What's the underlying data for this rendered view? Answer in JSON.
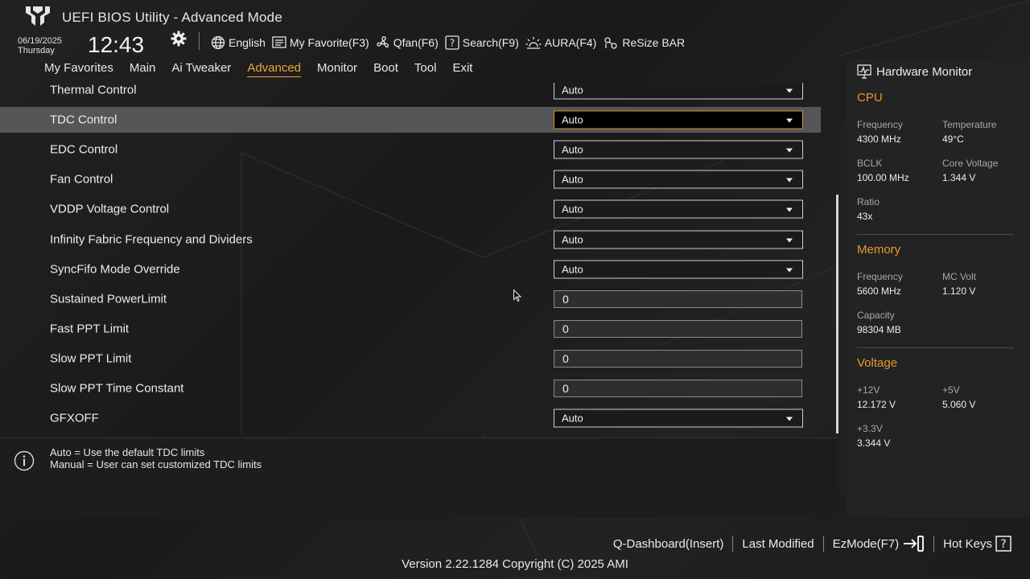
{
  "header": {
    "title": "UEFI BIOS Utility - Advanced Mode",
    "date": "06/19/2025",
    "day": "Thursday",
    "time": "12:43",
    "toolbar": [
      {
        "icon": "globe-icon",
        "label": "English"
      },
      {
        "icon": "my-favorite-icon",
        "label": "My Favorite(F3)"
      },
      {
        "icon": "fan-icon",
        "label": "Qfan(F6)"
      },
      {
        "icon": "search-icon",
        "label": "Search(F9)"
      },
      {
        "icon": "aura-icon",
        "label": "AURA(F4)"
      },
      {
        "icon": "resize-bar-icon",
        "label": "ReSize BAR"
      }
    ]
  },
  "nav": {
    "items": [
      "My Favorites",
      "Main",
      "Ai Tweaker",
      "Advanced",
      "Monitor",
      "Boot",
      "Tool",
      "Exit"
    ],
    "active": "Advanced"
  },
  "settings": [
    {
      "label": "Thermal Control",
      "type": "dropdown",
      "value": "Auto"
    },
    {
      "label": "TDC Control",
      "type": "dropdown",
      "value": "Auto",
      "selected": true
    },
    {
      "label": "EDC Control",
      "type": "dropdown",
      "value": "Auto"
    },
    {
      "label": "Fan Control",
      "type": "dropdown",
      "value": "Auto"
    },
    {
      "label": "VDDP Voltage Control",
      "type": "dropdown",
      "value": "Auto"
    },
    {
      "label": "Infinity Fabric Frequency and Dividers",
      "type": "dropdown",
      "value": "Auto"
    },
    {
      "label": "SyncFifo Mode Override",
      "type": "dropdown",
      "value": "Auto"
    },
    {
      "label": "Sustained PowerLimit",
      "type": "text",
      "value": "0"
    },
    {
      "label": "Fast PPT Limit",
      "type": "text",
      "value": "0"
    },
    {
      "label": "Slow PPT Limit",
      "type": "text",
      "value": "0"
    },
    {
      "label": "Slow PPT Time Constant",
      "type": "text",
      "value": "0"
    },
    {
      "label": "GFXOFF",
      "type": "dropdown",
      "value": "Auto"
    }
  ],
  "help": {
    "line1": "Auto = Use the default TDC limits",
    "line2": "Manual = User can set customized TDC limits"
  },
  "hardware_monitor": {
    "title": "Hardware Monitor",
    "cpu": {
      "heading": "CPU",
      "frequency_label": "Frequency",
      "frequency": "4300 MHz",
      "temperature_label": "Temperature",
      "temperature": "49°C",
      "bclk_label": "BCLK",
      "bclk": "100.00 MHz",
      "core_voltage_label": "Core Voltage",
      "core_voltage": "1.344 V",
      "ratio_label": "Ratio",
      "ratio": "43x"
    },
    "memory": {
      "heading": "Memory",
      "frequency_label": "Frequency",
      "frequency": "5600 MHz",
      "mc_volt_label": "MC Volt",
      "mc_volt": "1.120 V",
      "capacity_label": "Capacity",
      "capacity": "98304 MB"
    },
    "voltage": {
      "heading": "Voltage",
      "v12_label": "+12V",
      "v12": "12.172 V",
      "v5_label": "+5V",
      "v5": "5.060 V",
      "v33_label": "+3.3V",
      "v33": "3.344 V"
    }
  },
  "footer": {
    "qdashboard": "Q-Dashboard(Insert)",
    "last_modified": "Last Modified",
    "ezmode": "EzMode(F7)",
    "hotkeys": "Hot Keys",
    "version": "Version 2.22.1284 Copyright (C) 2025 AMI"
  },
  "colors": {
    "accent": "#f0a23a",
    "section_heading": "#e8982f",
    "selected_row": "#555657"
  }
}
